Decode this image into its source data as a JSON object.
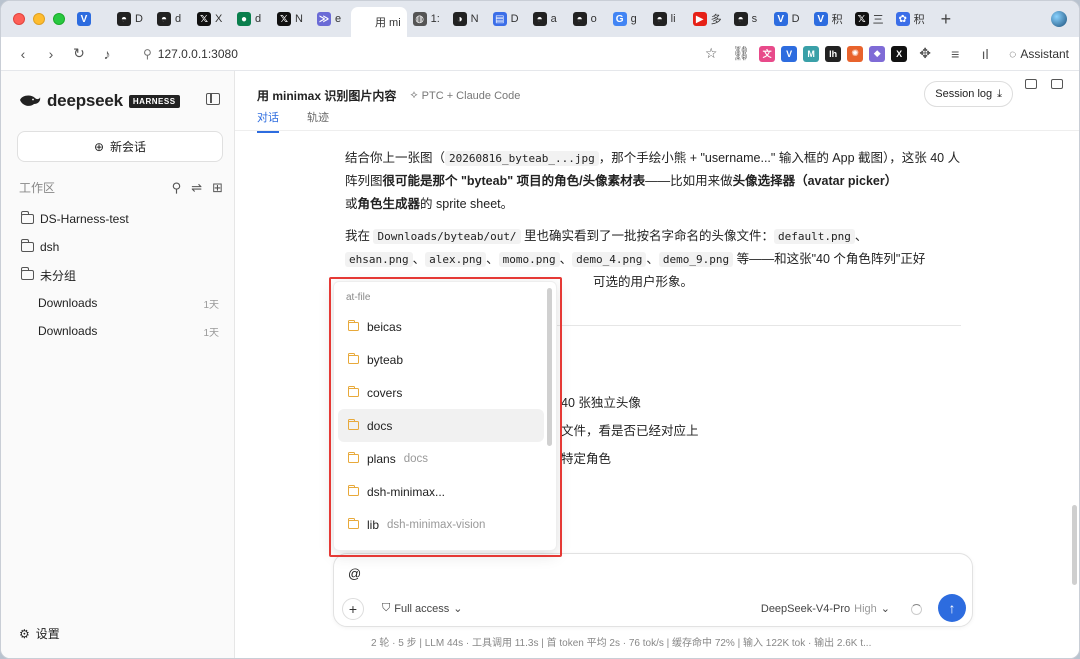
{
  "browser": {
    "tabs": [
      {
        "icon": "v-logo-icon",
        "label": "",
        "color": "#2d6cdf",
        "glyph": "V"
      },
      {
        "icon": "github-icon",
        "label": "D",
        "color": "#222",
        "glyph": "◓"
      },
      {
        "icon": "github-icon",
        "label": "d",
        "color": "#222",
        "glyph": "◓"
      },
      {
        "icon": "x-icon",
        "label": "X",
        "color": "#111",
        "glyph": "𝕏"
      },
      {
        "icon": "app-icon",
        "label": "d",
        "color": "#0a7f4d",
        "glyph": "●"
      },
      {
        "icon": "x-icon",
        "label": "N",
        "color": "#111",
        "glyph": "𝕏"
      },
      {
        "icon": "wing-icon",
        "label": "e",
        "color": "#6b6bd6",
        "glyph": "≫"
      },
      {
        "icon": "page-icon",
        "label": "用 mi",
        "color": "#666",
        "glyph": "",
        "active": true
      },
      {
        "icon": "globe-icon",
        "label": "1:",
        "color": "#555",
        "glyph": "◍"
      },
      {
        "icon": "app-icon",
        "label": "N",
        "color": "#222",
        "glyph": "◑"
      },
      {
        "icon": "doc-icon",
        "label": "D",
        "color": "#3b6ee8",
        "glyph": "▤"
      },
      {
        "icon": "github-icon",
        "label": "a",
        "color": "#222",
        "glyph": "◓"
      },
      {
        "icon": "github-icon",
        "label": "o",
        "color": "#222",
        "glyph": "◓"
      },
      {
        "icon": "google-icon",
        "label": "g",
        "color": "#4285f4",
        "glyph": "G"
      },
      {
        "icon": "github-icon",
        "label": "li",
        "color": "#222",
        "glyph": "◓"
      },
      {
        "icon": "youtube-icon",
        "label": "多",
        "color": "#e62117",
        "glyph": "▶"
      },
      {
        "icon": "github-icon",
        "label": "s",
        "color": "#222",
        "glyph": "◓"
      },
      {
        "icon": "v-logo-icon",
        "label": "D",
        "color": "#2d6cdf",
        "glyph": "V"
      },
      {
        "icon": "v-logo-icon",
        "label": "积",
        "color": "#2d6cdf",
        "glyph": "V"
      },
      {
        "icon": "x-icon",
        "label": "三",
        "color": "#111",
        "glyph": "𝕏"
      },
      {
        "icon": "paw-icon",
        "label": "积",
        "color": "#3b6ee8",
        "glyph": "✿"
      }
    ],
    "url": "127.0.0.1:3080",
    "assistant_label": "Assistant"
  },
  "sidebar": {
    "brand": "deepseek",
    "brand_badge": "HARNESS",
    "new_chat_label": "新会话",
    "workspace_label": "工作区",
    "items": [
      {
        "label": "DS-Harness-test",
        "meta": "",
        "sub": false
      },
      {
        "label": "dsh",
        "meta": "",
        "sub": false
      },
      {
        "label": "未分组",
        "meta": "",
        "sub": false
      },
      {
        "label": "Downloads",
        "meta": "1天",
        "sub": true
      },
      {
        "label": "Downloads",
        "meta": "1天",
        "sub": true
      }
    ],
    "settings_label": "设置"
  },
  "main": {
    "title": "用 minimax 识别图片内容",
    "subtitle": "PTC + Claude Code",
    "session_log_label": "Session log",
    "tabs": [
      {
        "label": "对话",
        "active": true
      },
      {
        "label": "轨迹",
        "active": false
      }
    ],
    "para1_a": "结合你上一张图（",
    "para1_code": "20260816_byteab_...jpg",
    "para1_b": "，那个手绘小熊 + \"username...\" 输入框的 App 截图），这张 40 人阵列图",
    "para1_bold1": "很可能是那个 \"byteab\" 项目的角色/头像素材表",
    "para1_c": "——比如用来做",
    "para1_bold2": "头像选择器（avatar picker）",
    "para1_d": "或",
    "para1_bold3": "角色生成器",
    "para1_e": "的 sprite sheet。",
    "para2_a": "我在 ",
    "para2_code1": "Downloads/byteab/out/",
    "para2_b": " 里也确实看到了一批按名字命名的头像文件：",
    "para2_code2": "default.png",
    "para2_c": "、",
    "para2_code3": "ehsan.png",
    "para2_code4": "alex.png",
    "para2_code5": "momo.png",
    "para2_code6": "demo_4.png",
    "para2_code7": "demo_9.png",
    "para2_d": " 等——和这张\"40 个角色阵列\"正好",
    "para2_e": "可选的用户形象。",
    "list_line1": "40 张独立头像",
    "list_line2": "文件，看是否已经对应上",
    "list_line3": "特定角色"
  },
  "popup": {
    "label": "at-file",
    "items": [
      {
        "name": "beicas",
        "sub": "",
        "highlight": false
      },
      {
        "name": "byteab",
        "sub": "",
        "highlight": false
      },
      {
        "name": "covers",
        "sub": "",
        "highlight": false
      },
      {
        "name": "docs",
        "sub": "",
        "highlight": true
      },
      {
        "name": "plans",
        "sub": "docs",
        "highlight": false
      },
      {
        "name": "dsh-minimax...",
        "sub": "",
        "highlight": false
      },
      {
        "name": "lib",
        "sub": "dsh-minimax-vision",
        "highlight": false
      }
    ]
  },
  "composer": {
    "value": "@",
    "access_label": "Full access",
    "model_label": "DeepSeek-V4-Pro",
    "model_level": "High"
  },
  "status": "2 轮 · 5 步  |  LLM 44s · 工具调用 11.3s  |  首 token 平均 2s · 76 tok/s  |  缓存命中 72%  |  输入 122K tok · 输出 2.6K t..."
}
